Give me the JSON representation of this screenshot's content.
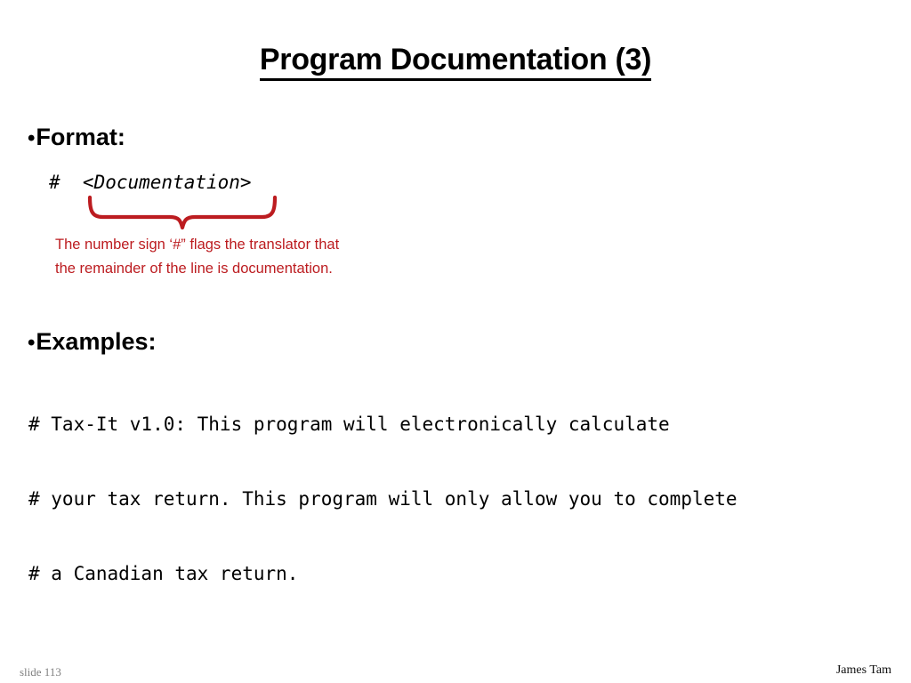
{
  "slide": {
    "title": "Program Documentation (3)",
    "background_color": "#FFFFFF",
    "accent_red": "#BC1C20"
  },
  "bullets": {
    "marker": "•",
    "format": {
      "label": "Format:",
      "code": "#  <Documentation>"
    },
    "examples": {
      "label": "Examples:"
    }
  },
  "annotation": {
    "brace_name": "curly-brace-down",
    "brace_color": "#BC1C20",
    "line1": "The number sign ‘#” flags the translator that",
    "line2": "the remainder of the line is documentation."
  },
  "examples_code": {
    "lines": [
      "# Tax-It v1.0: This program will electronically calculate",
      "# your tax return. This program will only allow you to complete",
      "# a Canadian tax return."
    ]
  },
  "footer": {
    "slide_number": "slide 113",
    "author": "James Tam"
  }
}
